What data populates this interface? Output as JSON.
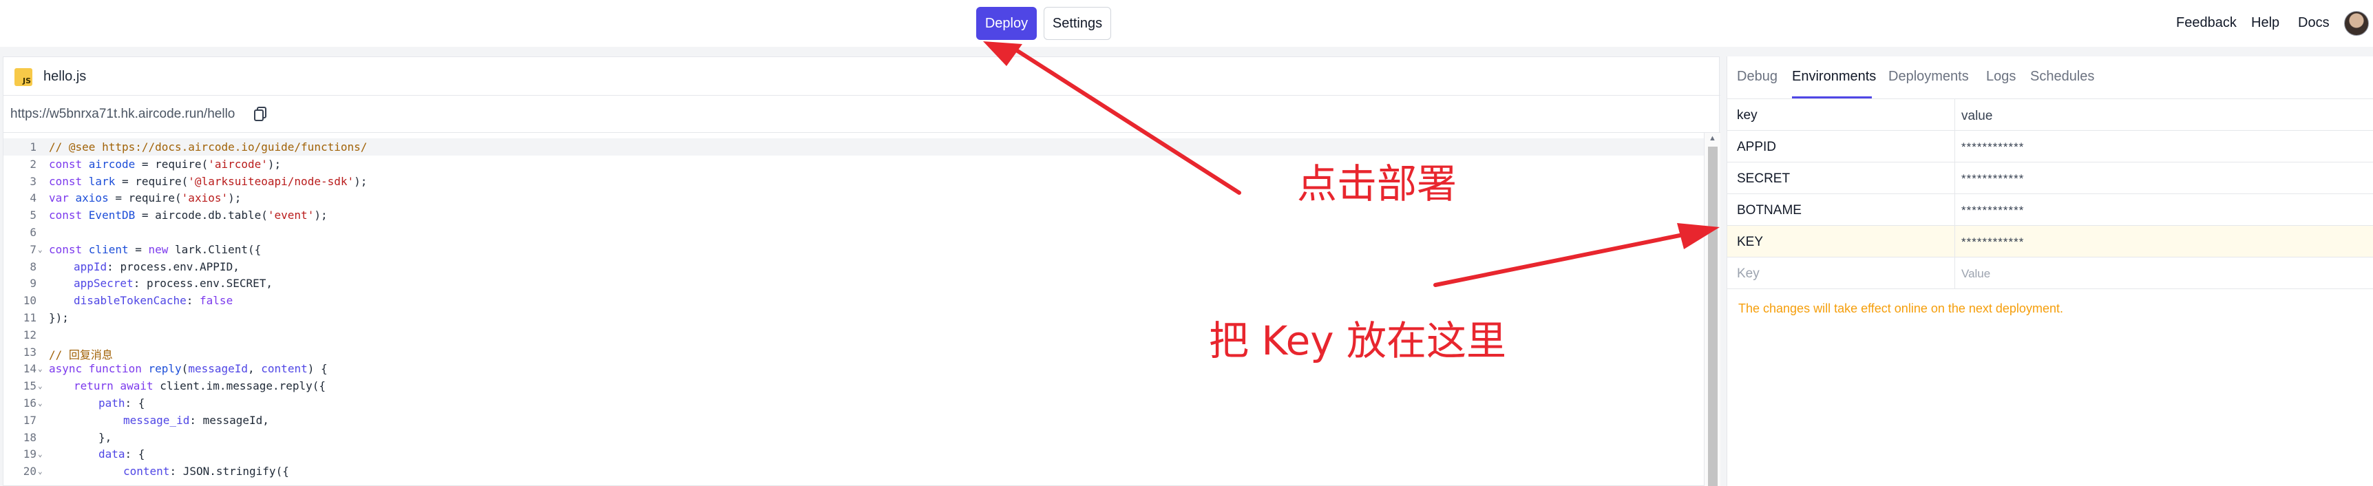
{
  "topbar": {
    "deploy_label": "Deploy",
    "settings_label": "Settings",
    "feedback_label": "Feedback",
    "help_label": "Help",
    "docs_label": "Docs"
  },
  "editor": {
    "file_name": "hello.js",
    "file_icon": "js-file-icon",
    "url": "https://w5bnrxa71t.hk.aircode.run/hello",
    "lines": [
      {
        "n": "1",
        "fold": "",
        "indent": 0,
        "tokens": [
          [
            "c",
            "// @see https://docs.aircode.io/guide/functions/"
          ]
        ]
      },
      {
        "n": "2",
        "fold": "",
        "indent": 0,
        "tokens": [
          [
            "k",
            "const "
          ],
          [
            "v",
            "aircode"
          ],
          [
            "",
            " = require("
          ],
          [
            "s",
            "'aircode'"
          ],
          [
            "",
            ");"
          ]
        ]
      },
      {
        "n": "3",
        "fold": "",
        "indent": 0,
        "tokens": [
          [
            "k",
            "const "
          ],
          [
            "v",
            "lark"
          ],
          [
            "",
            " = require("
          ],
          [
            "s",
            "'@larksuiteoapi/node-sdk'"
          ],
          [
            "",
            ");"
          ]
        ]
      },
      {
        "n": "4",
        "fold": "",
        "indent": 0,
        "tokens": [
          [
            "k",
            "var "
          ],
          [
            "v",
            "axios"
          ],
          [
            "",
            " = require("
          ],
          [
            "s",
            "'axios'"
          ],
          [
            "",
            ");"
          ]
        ]
      },
      {
        "n": "5",
        "fold": "",
        "indent": 0,
        "tokens": [
          [
            "k",
            "const "
          ],
          [
            "v",
            "EventDB"
          ],
          [
            "",
            " = aircode.db.table("
          ],
          [
            "s",
            "'event'"
          ],
          [
            "",
            ");"
          ]
        ]
      },
      {
        "n": "6",
        "fold": "",
        "indent": 0,
        "tokens": []
      },
      {
        "n": "7",
        "fold": "⌄",
        "indent": 0,
        "tokens": [
          [
            "k",
            "const "
          ],
          [
            "v",
            "client"
          ],
          [
            "",
            " = "
          ],
          [
            "k",
            "new "
          ],
          [
            "",
            "lark.Client({"
          ]
        ]
      },
      {
        "n": "8",
        "fold": "",
        "indent": 1,
        "tokens": [
          [
            "p",
            "appId"
          ],
          [
            "",
            ": process.env.APPID,"
          ]
        ]
      },
      {
        "n": "9",
        "fold": "",
        "indent": 1,
        "tokens": [
          [
            "p",
            "appSecret"
          ],
          [
            "",
            ": process.env.SECRET,"
          ]
        ]
      },
      {
        "n": "10",
        "fold": "",
        "indent": 1,
        "tokens": [
          [
            "p",
            "disableTokenCache"
          ],
          [
            "",
            ": "
          ],
          [
            "k",
            "false"
          ]
        ]
      },
      {
        "n": "11",
        "fold": "",
        "indent": 0,
        "tokens": [
          [
            "",
            "});"
          ]
        ]
      },
      {
        "n": "12",
        "fold": "",
        "indent": 0,
        "tokens": []
      },
      {
        "n": "13",
        "fold": "",
        "indent": 0,
        "tokens": [
          [
            "c",
            "// 回复消息"
          ]
        ]
      },
      {
        "n": "14",
        "fold": "⌄",
        "indent": 0,
        "tokens": [
          [
            "k",
            "async function "
          ],
          [
            "v",
            "reply"
          ],
          [
            "",
            "("
          ],
          [
            "p",
            "messageId"
          ],
          [
            "",
            ", "
          ],
          [
            "p",
            "content"
          ],
          [
            "",
            ") {"
          ]
        ]
      },
      {
        "n": "15",
        "fold": "⌄",
        "indent": 1,
        "tokens": [
          [
            "k",
            "return await "
          ],
          [
            "",
            "client.im.message.reply({"
          ]
        ]
      },
      {
        "n": "16",
        "fold": "⌄",
        "indent": 2,
        "tokens": [
          [
            "p",
            "path"
          ],
          [
            "",
            ": {"
          ]
        ]
      },
      {
        "n": "17",
        "fold": "",
        "indent": 3,
        "tokens": [
          [
            "p",
            "message_id"
          ],
          [
            "",
            ": messageId,"
          ]
        ]
      },
      {
        "n": "18",
        "fold": "",
        "indent": 2,
        "tokens": [
          [
            "",
            "},"
          ]
        ]
      },
      {
        "n": "19",
        "fold": "⌄",
        "indent": 2,
        "tokens": [
          [
            "p",
            "data"
          ],
          [
            "",
            ": {"
          ]
        ]
      },
      {
        "n": "20",
        "fold": "⌄",
        "indent": 3,
        "tokens": [
          [
            "p",
            "content"
          ],
          [
            "",
            ": JSON.stringify({"
          ]
        ]
      }
    ]
  },
  "right_panel": {
    "tabs": [
      {
        "label": "Debug",
        "active": false
      },
      {
        "label": "Environments",
        "active": true
      },
      {
        "label": "Deployments",
        "active": false
      },
      {
        "label": "Logs",
        "active": false
      },
      {
        "label": "Schedules",
        "active": false
      }
    ],
    "table": {
      "headers": {
        "key": "key",
        "value": "value"
      },
      "rows": [
        {
          "key": "APPID",
          "value": "************",
          "highlight": false
        },
        {
          "key": "SECRET",
          "value": "************",
          "highlight": false
        },
        {
          "key": "BOTNAME",
          "value": "************",
          "highlight": false
        },
        {
          "key": "KEY",
          "value": "************",
          "highlight": true
        }
      ],
      "new_row": {
        "key_placeholder": "Key",
        "value_placeholder": "Value"
      }
    },
    "notice": "The changes will take effect online on the next deployment."
  },
  "annotations": {
    "deploy_hint": "点击部署",
    "key_hint": "把 Key 放在这里"
  },
  "colors": {
    "accent": "#4f46e5",
    "annotation": "#e8262e",
    "notice": "#f59e0b"
  }
}
